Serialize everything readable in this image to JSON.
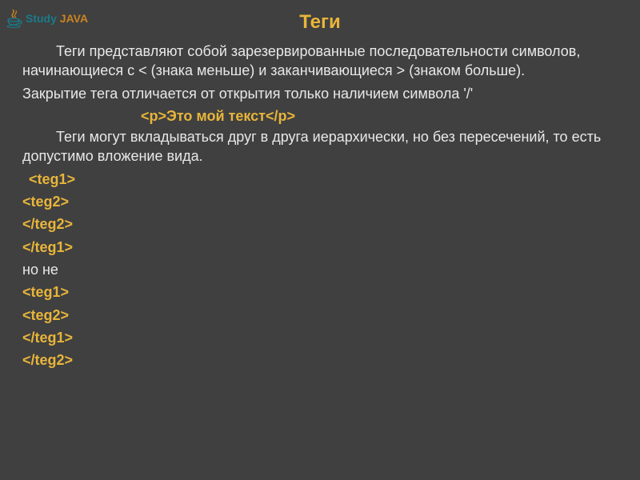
{
  "logo": {
    "study": "Study",
    "java": "JAVA"
  },
  "title": "Теги",
  "para1": "Теги представляют собой зарезервированные последовательности символов, начинающиеся с < (знака меньше) и заканчивающиеся > (знаком больше).",
  "para2": "Закрытие тега отличается от открытия только наличием символа '/'",
  "example": "<p>Это мой текст</p>",
  "para3": "Теги могут вкладываться друг в друга иерархически, но без пересечений, то есть допустимо вложение вида.",
  "code": {
    "l1": "<teg1>",
    "l2": "<teg2>",
    "l3": "</teg2>",
    "l4": "</teg1>",
    "but": "но не",
    "l5": "<teg1>",
    "l6": "<teg2>",
    "l7": "</teg1>",
    "l8": "</teg2>"
  }
}
